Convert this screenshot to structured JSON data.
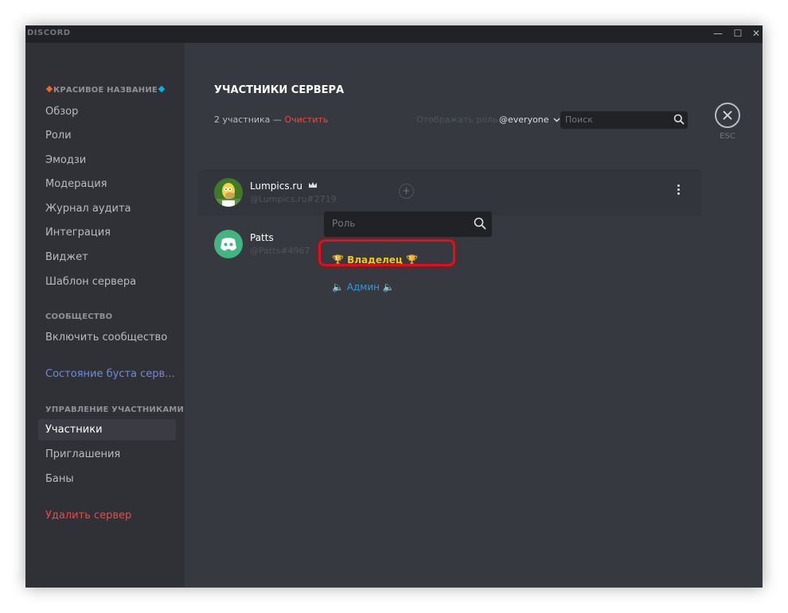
{
  "window": {
    "logo": "DISCORD",
    "controls": {
      "minimize": "—",
      "maximize": "☐",
      "close": "✕"
    }
  },
  "sidebar": {
    "server_name": "КРАСИВОЕ НАЗВАНИЕ",
    "server_items": [
      "Обзор",
      "Роли",
      "Эмодзи",
      "Модерация",
      "Журнал аудита",
      "Интеграция",
      "Виджет",
      "Шаблон сервера"
    ],
    "community_heading": "СООБЩЕСТВО",
    "community_item": "Включить сообщество",
    "boost_status": "Состояние буста серв...",
    "members_heading": "УПРАВЛЕНИЕ УЧАСТНИКАМИ",
    "members_items": [
      "Участники",
      "Приглашения",
      "Баны"
    ],
    "delete_server": "Удалить сервер",
    "colors": {
      "boost": "#7289da",
      "delete": "#f04747",
      "diamond_left": "#f26522",
      "diamond_right": "#00b0f4"
    }
  },
  "main": {
    "title": "УЧАСТНИКИ СЕРВЕРА",
    "member_count": "2 участника —",
    "clear_label": "Очистить",
    "role_filter_label": "Отображать роль",
    "role_filter_value": "@everyone",
    "search_placeholder": "Поиск",
    "esc_label": "ESC"
  },
  "members": [
    {
      "name": "Lumpics.ru",
      "tag": "@Lumpics.ru#2719",
      "owner_icon": "crown-icon",
      "avatar": "homer-avatar"
    },
    {
      "name": "Patts",
      "tag": "@Patts#4967",
      "avatar": "discord-logo-avatar",
      "avatar_color": "#43b581"
    }
  ],
  "role_popup": {
    "search_placeholder": "Роль",
    "roles": [
      {
        "label": "🏆 Владелец 🏆",
        "color": "#f1c40f"
      },
      {
        "label": "🔈 Админ 🔈",
        "color": "#3498db"
      }
    ]
  }
}
